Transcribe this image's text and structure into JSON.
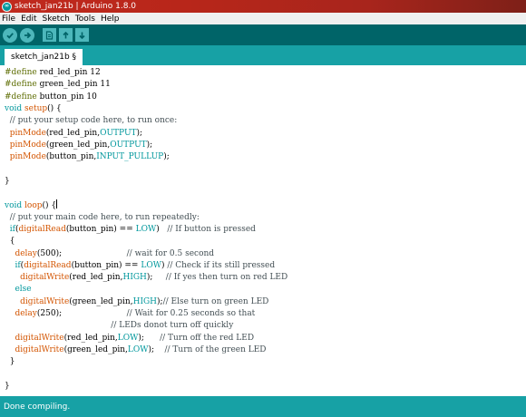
{
  "window": {
    "title": "sketch_jan21b | Arduino 1.8.0",
    "logo_glyph": "∞"
  },
  "menu": [
    "File",
    "Edit",
    "Sketch",
    "Tools",
    "Help"
  ],
  "toolbar": {
    "buttons": [
      "verify-icon",
      "upload-icon",
      "new-icon",
      "open-icon",
      "save-icon"
    ]
  },
  "tabs": [
    {
      "label": "sketch_jan21b §",
      "active": true
    }
  ],
  "colors": {
    "title_bar": "#b8261a",
    "toolbar": "#006468",
    "tab_bar": "#17a1a5",
    "status_bar": "#17a1a5",
    "preprocessor": "#5e6d03",
    "keyword": "#00979c",
    "function": "#d35400",
    "comment": "#434f54"
  },
  "code": [
    [
      [
        "pp",
        "#define "
      ],
      [
        "",
        "red_led_pin 12"
      ]
    ],
    [
      [
        "pp",
        "#define "
      ],
      [
        "",
        "green_led_pin 11"
      ]
    ],
    [
      [
        "pp",
        "#define "
      ],
      [
        "",
        "button_pin 10"
      ]
    ],
    [
      [
        "kw",
        "void "
      ],
      [
        "fn",
        "setup"
      ],
      [
        "",
        "() {"
      ]
    ],
    [
      [
        "cm",
        "  // put your setup code here, to run once:"
      ]
    ],
    [
      [
        "",
        "  "
      ],
      [
        "fn",
        "pinMode"
      ],
      [
        "",
        "(red_led_pin,"
      ],
      [
        "const",
        "OUTPUT"
      ],
      [
        "",
        ");"
      ]
    ],
    [
      [
        "",
        "  "
      ],
      [
        "fn",
        "pinMode"
      ],
      [
        "",
        "(green_led_pin,"
      ],
      [
        "const",
        "OUTPUT"
      ],
      [
        "",
        ");"
      ]
    ],
    [
      [
        "",
        "  "
      ],
      [
        "fn",
        "pinMode"
      ],
      [
        "",
        "(button_pin,"
      ],
      [
        "const",
        "INPUT_PULLUP"
      ],
      [
        "",
        ");"
      ]
    ],
    [
      [
        "",
        ""
      ]
    ],
    [
      [
        "",
        "}"
      ]
    ],
    [
      [
        "",
        ""
      ]
    ],
    [
      [
        "kw",
        "void "
      ],
      [
        "fn",
        "loop"
      ],
      [
        "",
        "() {"
      ]
    ],
    [
      [
        "cm",
        "  // put your main code here, to run repeatedly:"
      ]
    ],
    [
      [
        "",
        "  "
      ],
      [
        "kw",
        "if"
      ],
      [
        "",
        "("
      ],
      [
        "fn",
        "digitalRead"
      ],
      [
        "",
        "(button_pin) == "
      ],
      [
        "const",
        "LOW"
      ],
      [
        "",
        ")   "
      ],
      [
        "cm",
        "// If button is pressed"
      ]
    ],
    [
      [
        "",
        "  {"
      ]
    ],
    [
      [
        "",
        "    "
      ],
      [
        "fn",
        "delay"
      ],
      [
        "",
        "(500);                         "
      ],
      [
        "cm",
        "// wait for 0.5 second"
      ]
    ],
    [
      [
        "",
        "    "
      ],
      [
        "kw",
        "if"
      ],
      [
        "",
        "("
      ],
      [
        "fn",
        "digitalRead"
      ],
      [
        "",
        "(button_pin) == "
      ],
      [
        "const",
        "LOW"
      ],
      [
        "",
        ") "
      ],
      [
        "cm",
        "// Check if its still pressed"
      ]
    ],
    [
      [
        "",
        "      "
      ],
      [
        "fn",
        "digitalWrite"
      ],
      [
        "",
        "(red_led_pin,"
      ],
      [
        "const",
        "HIGH"
      ],
      [
        "",
        ");     "
      ],
      [
        "cm",
        "// If yes then turn on red LED"
      ]
    ],
    [
      [
        "",
        "    "
      ],
      [
        "kw",
        "else"
      ]
    ],
    [
      [
        "",
        "      "
      ],
      [
        "fn",
        "digitalWrite"
      ],
      [
        "",
        "(green_led_pin,"
      ],
      [
        "const",
        "HIGH"
      ],
      [
        "",
        ");"
      ],
      [
        "cm",
        "// Else turn on green LED"
      ]
    ],
    [
      [
        "",
        "    "
      ],
      [
        "fn",
        "delay"
      ],
      [
        "",
        "(250);                         "
      ],
      [
        "cm",
        "// Wait for 0.25 seconds so that"
      ]
    ],
    [
      [
        "",
        "                                         "
      ],
      [
        "cm",
        "// LEDs donot turn off quickly"
      ]
    ],
    [
      [
        "",
        "    "
      ],
      [
        "fn",
        "digitalWrite"
      ],
      [
        "",
        "(red_led_pin,"
      ],
      [
        "const",
        "LOW"
      ],
      [
        "",
        ");      "
      ],
      [
        "cm",
        "// Turn off the red LED"
      ]
    ],
    [
      [
        "",
        "    "
      ],
      [
        "fn",
        "digitalWrite"
      ],
      [
        "",
        "(green_led_pin,"
      ],
      [
        "const",
        "LOW"
      ],
      [
        "",
        ");    "
      ],
      [
        "cm",
        "// Turn of the green LED"
      ]
    ],
    [
      [
        "",
        "  }"
      ]
    ],
    [
      [
        "",
        ""
      ]
    ],
    [
      [
        "",
        "}"
      ]
    ]
  ],
  "status": {
    "text": "Done compiling."
  }
}
